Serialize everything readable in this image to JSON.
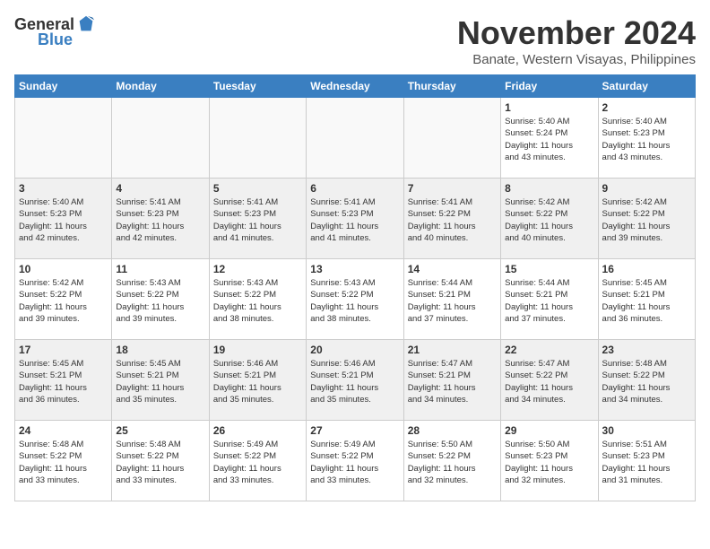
{
  "logo": {
    "general": "General",
    "blue": "Blue"
  },
  "title": "November 2024",
  "location": "Banate, Western Visayas, Philippines",
  "weekdays": [
    "Sunday",
    "Monday",
    "Tuesday",
    "Wednesday",
    "Thursday",
    "Friday",
    "Saturday"
  ],
  "weeks": [
    [
      {
        "day": "",
        "info": ""
      },
      {
        "day": "",
        "info": ""
      },
      {
        "day": "",
        "info": ""
      },
      {
        "day": "",
        "info": ""
      },
      {
        "day": "",
        "info": ""
      },
      {
        "day": "1",
        "info": "Sunrise: 5:40 AM\nSunset: 5:24 PM\nDaylight: 11 hours\nand 43 minutes."
      },
      {
        "day": "2",
        "info": "Sunrise: 5:40 AM\nSunset: 5:23 PM\nDaylight: 11 hours\nand 43 minutes."
      }
    ],
    [
      {
        "day": "3",
        "info": "Sunrise: 5:40 AM\nSunset: 5:23 PM\nDaylight: 11 hours\nand 42 minutes."
      },
      {
        "day": "4",
        "info": "Sunrise: 5:41 AM\nSunset: 5:23 PM\nDaylight: 11 hours\nand 42 minutes."
      },
      {
        "day": "5",
        "info": "Sunrise: 5:41 AM\nSunset: 5:23 PM\nDaylight: 11 hours\nand 41 minutes."
      },
      {
        "day": "6",
        "info": "Sunrise: 5:41 AM\nSunset: 5:23 PM\nDaylight: 11 hours\nand 41 minutes."
      },
      {
        "day": "7",
        "info": "Sunrise: 5:41 AM\nSunset: 5:22 PM\nDaylight: 11 hours\nand 40 minutes."
      },
      {
        "day": "8",
        "info": "Sunrise: 5:42 AM\nSunset: 5:22 PM\nDaylight: 11 hours\nand 40 minutes."
      },
      {
        "day": "9",
        "info": "Sunrise: 5:42 AM\nSunset: 5:22 PM\nDaylight: 11 hours\nand 39 minutes."
      }
    ],
    [
      {
        "day": "10",
        "info": "Sunrise: 5:42 AM\nSunset: 5:22 PM\nDaylight: 11 hours\nand 39 minutes."
      },
      {
        "day": "11",
        "info": "Sunrise: 5:43 AM\nSunset: 5:22 PM\nDaylight: 11 hours\nand 39 minutes."
      },
      {
        "day": "12",
        "info": "Sunrise: 5:43 AM\nSunset: 5:22 PM\nDaylight: 11 hours\nand 38 minutes."
      },
      {
        "day": "13",
        "info": "Sunrise: 5:43 AM\nSunset: 5:22 PM\nDaylight: 11 hours\nand 38 minutes."
      },
      {
        "day": "14",
        "info": "Sunrise: 5:44 AM\nSunset: 5:21 PM\nDaylight: 11 hours\nand 37 minutes."
      },
      {
        "day": "15",
        "info": "Sunrise: 5:44 AM\nSunset: 5:21 PM\nDaylight: 11 hours\nand 37 minutes."
      },
      {
        "day": "16",
        "info": "Sunrise: 5:45 AM\nSunset: 5:21 PM\nDaylight: 11 hours\nand 36 minutes."
      }
    ],
    [
      {
        "day": "17",
        "info": "Sunrise: 5:45 AM\nSunset: 5:21 PM\nDaylight: 11 hours\nand 36 minutes."
      },
      {
        "day": "18",
        "info": "Sunrise: 5:45 AM\nSunset: 5:21 PM\nDaylight: 11 hours\nand 35 minutes."
      },
      {
        "day": "19",
        "info": "Sunrise: 5:46 AM\nSunset: 5:21 PM\nDaylight: 11 hours\nand 35 minutes."
      },
      {
        "day": "20",
        "info": "Sunrise: 5:46 AM\nSunset: 5:21 PM\nDaylight: 11 hours\nand 35 minutes."
      },
      {
        "day": "21",
        "info": "Sunrise: 5:47 AM\nSunset: 5:21 PM\nDaylight: 11 hours\nand 34 minutes."
      },
      {
        "day": "22",
        "info": "Sunrise: 5:47 AM\nSunset: 5:22 PM\nDaylight: 11 hours\nand 34 minutes."
      },
      {
        "day": "23",
        "info": "Sunrise: 5:48 AM\nSunset: 5:22 PM\nDaylight: 11 hours\nand 34 minutes."
      }
    ],
    [
      {
        "day": "24",
        "info": "Sunrise: 5:48 AM\nSunset: 5:22 PM\nDaylight: 11 hours\nand 33 minutes."
      },
      {
        "day": "25",
        "info": "Sunrise: 5:48 AM\nSunset: 5:22 PM\nDaylight: 11 hours\nand 33 minutes."
      },
      {
        "day": "26",
        "info": "Sunrise: 5:49 AM\nSunset: 5:22 PM\nDaylight: 11 hours\nand 33 minutes."
      },
      {
        "day": "27",
        "info": "Sunrise: 5:49 AM\nSunset: 5:22 PM\nDaylight: 11 hours\nand 33 minutes."
      },
      {
        "day": "28",
        "info": "Sunrise: 5:50 AM\nSunset: 5:22 PM\nDaylight: 11 hours\nand 32 minutes."
      },
      {
        "day": "29",
        "info": "Sunrise: 5:50 AM\nSunset: 5:23 PM\nDaylight: 11 hours\nand 32 minutes."
      },
      {
        "day": "30",
        "info": "Sunrise: 5:51 AM\nSunset: 5:23 PM\nDaylight: 11 hours\nand 31 minutes."
      }
    ]
  ]
}
